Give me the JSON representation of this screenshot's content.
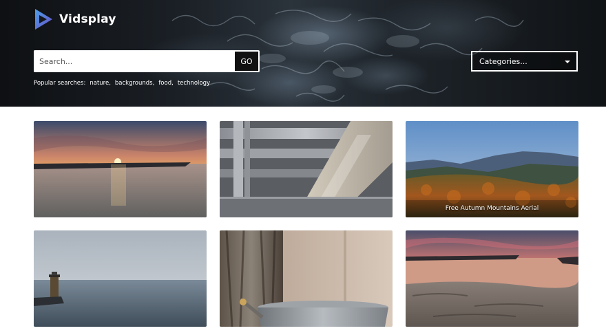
{
  "brand": {
    "name": "Vidsplay",
    "logo_icon": "play-triangle-icon"
  },
  "search": {
    "placeholder": "Search...",
    "button_label": "GO"
  },
  "popular": {
    "label": "Popular searches:",
    "tags": [
      "nature,",
      "backgrounds,",
      "food,",
      "technology"
    ]
  },
  "categories": {
    "selected": "Categories..."
  },
  "videos": [
    {
      "title": ""
    },
    {
      "title": ""
    },
    {
      "title": "Free Autumn Mountains Aerial"
    },
    {
      "title": ""
    },
    {
      "title": ""
    },
    {
      "title": ""
    }
  ],
  "colors": {
    "hero_dark": "#1b2026",
    "logo_blue": "#3a7bd5",
    "logo_purple": "#6a4fc8"
  }
}
